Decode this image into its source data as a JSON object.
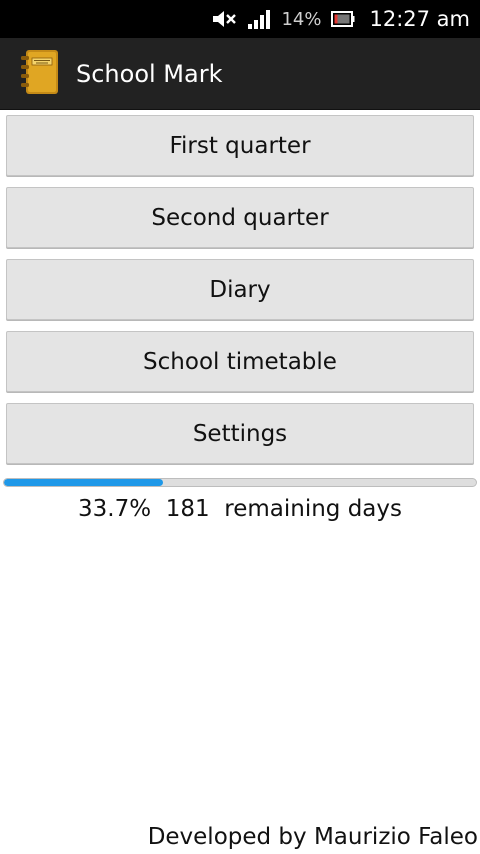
{
  "status_bar": {
    "battery_percent": "14%",
    "time": "12:27 am",
    "icons": [
      "volume-muted-icon",
      "signal-icon",
      "battery-icon"
    ]
  },
  "action_bar": {
    "title": "School Mark",
    "icon": "diary-book-icon"
  },
  "menu": [
    {
      "label": "First quarter"
    },
    {
      "label": "Second quarter"
    },
    {
      "label": "Diary"
    },
    {
      "label": "School timetable"
    },
    {
      "label": "Settings"
    }
  ],
  "progress": {
    "fraction": 0.337,
    "percent_text": "33.7%",
    "remaining_days": "181",
    "remaining_label": "remaining days"
  },
  "footer": {
    "credit": "Developed by Maurizio Faleo"
  },
  "colors": {
    "progress_fill": "#1f98e8",
    "action_bar_bg": "#222222",
    "status_bar_bg": "#000000"
  }
}
